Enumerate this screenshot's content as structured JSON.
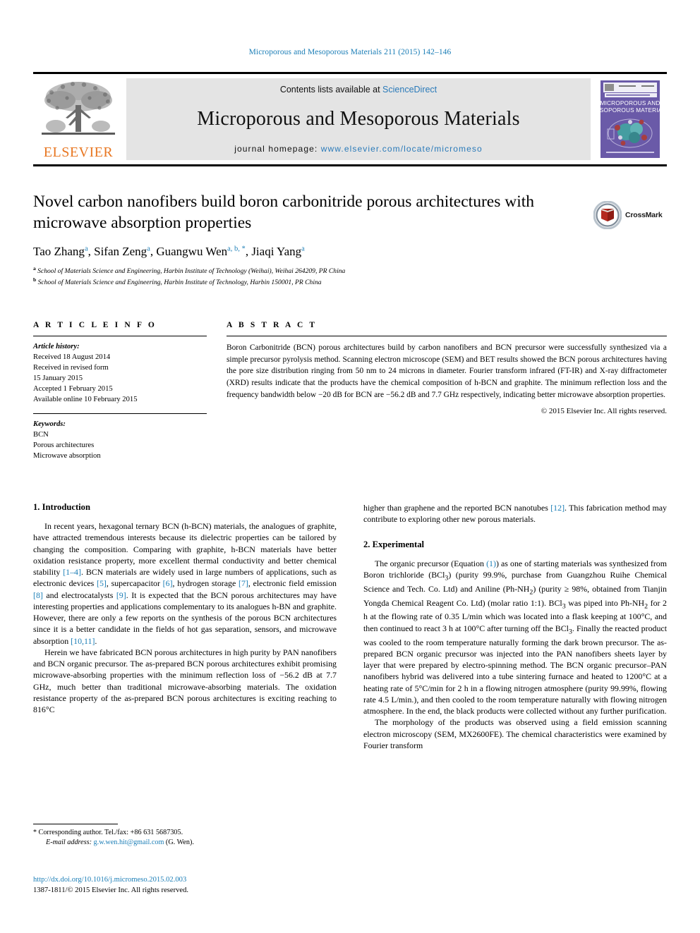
{
  "running_head": "Microporous and Mesoporous Materials 211 (2015) 142–146",
  "masthead": {
    "publisher_name": "ELSEVIER",
    "contents_prefix": "Contents lists available at ",
    "contents_link": "ScienceDirect",
    "journal_title": "Microporous and Mesoporous Materials",
    "homepage_prefix": "journal homepage: ",
    "homepage_link": "www.elsevier.com/locate/micromeso",
    "cover_title_line1": "MICROPOROUS AND",
    "cover_title_line2": "MESOPOROUS MATERIALS"
  },
  "article": {
    "title": "Novel carbon nanofibers build boron carbonitride porous architectures with microwave absorption properties",
    "authors": [
      {
        "name": "Tao Zhang",
        "marks": "a"
      },
      {
        "name": "Sifan Zeng",
        "marks": "a"
      },
      {
        "name": "Guangwu Wen",
        "marks": "a, b, *"
      },
      {
        "name": "Jiaqi Yang",
        "marks": "a"
      }
    ],
    "affiliations": [
      {
        "mark": "a",
        "text": "School of Materials Science and Engineering, Harbin Institute of Technology (Weihai), Weihai 264209, PR China"
      },
      {
        "mark": "b",
        "text": "School of Materials Science and Engineering, Harbin Institute of Technology, Harbin 150001, PR China"
      }
    ],
    "crossmark_label": "CrossMark"
  },
  "article_info": {
    "heading": "A R T I C L E   I N F O",
    "history_label": "Article history:",
    "history": [
      "Received 18 August 2014",
      "Received in revised form",
      "15 January 2015",
      "Accepted 1 February 2015",
      "Available online 10 February 2015"
    ],
    "keywords_label": "Keywords:",
    "keywords": [
      "BCN",
      "Porous architectures",
      "Microwave absorption"
    ]
  },
  "abstract": {
    "heading": "A B S T R A C T",
    "text": "Boron Carbonitride (BCN) porous architectures build by carbon nanofibers and BCN precursor were successfully synthesized via a simple precursor pyrolysis method. Scanning electron microscope (SEM) and BET results showed the BCN porous architectures having the pore size distribution ringing from 50 nm to 24 microns in diameter. Fourier transform infrared (FT-IR) and X-ray diffractometer (XRD) results indicate that the products have the chemical composition of h-BCN and graphite. The minimum reflection loss and the frequency bandwidth below −20 dB for BCN are −56.2 dB and 7.7 GHz respectively, indicating better microwave absorption properties.",
    "copyright": "© 2015 Elsevier Inc. All rights reserved."
  },
  "sections": {
    "introduction_heading": "1. Introduction",
    "intro_p1_a": "In recent years, hexagonal ternary BCN (h-BCN) materials, the analogues of graphite, have attracted tremendous interests because its dielectric properties can be tailored by changing the composition. Comparing with graphite, h-BCN materials have better oxidation resistance property, more excellent thermal conductivity and better chemical stability ",
    "intro_ref_1_4": "[1–4]",
    "intro_p1_b": ". BCN materials are widely used in large numbers of applications, such as electronic devices ",
    "intro_ref_5": "[5]",
    "intro_p1_c": ", supercapacitor ",
    "intro_ref_6": "[6]",
    "intro_p1_d": ", hydrogen storage ",
    "intro_ref_7": "[7]",
    "intro_p1_e": ", electronic field emission ",
    "intro_ref_8": "[8]",
    "intro_p1_f": " and electrocatalysts ",
    "intro_ref_9": "[9]",
    "intro_p1_g": ". It is expected that the BCN porous architectures may have interesting properties and applications complementary to its analogues h-BN and graphite. However, there are only a few reports on the synthesis of the porous BCN architectures since it is a better candidate in the fields of hot gas separation, sensors, and microwave absorption ",
    "intro_ref_10_11": "[10,11]",
    "intro_p1_h": ".",
    "intro_p2": "Herein we have fabricated BCN porous architectures in high purity by PAN nanofibers and BCN organic precursor. The as-prepared BCN porous architectures exhibit promising microwave-absorbing properties with the minimum reflection loss of −56.2 dB at 7.7 GHz, much better than traditional microwave-absorbing materials. The oxidation resistance property of the as-prepared BCN porous architectures is exciting reaching to 816°C",
    "right_p1_a": "higher than graphene and the reported BCN nanotubes ",
    "right_ref_12": "[12]",
    "right_p1_b": ". This fabrication method may contribute to exploring other new porous materials.",
    "experimental_heading": "2. Experimental",
    "exp_p1_a": "The organic precursor (Equation ",
    "exp_eq_ref": "(1)",
    "exp_p1_b": ") as one of starting materials was synthesized from Boron trichloride (BCl",
    "exp_p1_c": ") (purity 99.9%, purchase from Guangzhou Ruihe Chemical Science and Tech. Co. Ltd) and Aniline (Ph-NH",
    "exp_p1_d": ") (purity ≥ 98%, obtained from Tianjin Yongda Chemical Reagent Co. Ltd) (molar ratio 1:1). BCl",
    "exp_p1_e": " was piped into Ph-NH",
    "exp_p1_f": " for 2 h at the flowing rate of 0.35 L/min which was located into a flask keeping at 100°C, and then continued to react 3 h at 100°C after turning off the BCl",
    "exp_p1_g": ". Finally the reacted product was cooled to the room temperature naturally forming the dark brown precursor. The as-prepared BCN organic precursor was injected into the PAN nanofibers sheets layer by layer that were prepared by electro-spinning method. The BCN organic precursor–PAN nanofibers hybrid was delivered into a tube sintering furnace and heated to 1200°C at a heating rate of 5°C/min for 2 h in a flowing nitrogen atmosphere (purity 99.99%, flowing rate 4.5 L/min.), and then cooled to the room temperature naturally with flowing nitrogen atmosphere. In the end, the black products were collected without any further purification.",
    "exp_p2": "The morphology of the products was observed using a field emission scanning electron microscopy (SEM, MX2600FE). The chemical characteristics were examined by Fourier transform",
    "sub_3": "3",
    "sub_2": "2"
  },
  "footnotes": {
    "corresponding": "Corresponding author. Tel./fax: +86 631 5687305.",
    "email_label": "E-mail address:",
    "email": "g.w.wen.hit@gmail.com",
    "email_suffix": "(G. Wen).",
    "doi": "http://dx.doi.org/10.1016/j.micromeso.2015.02.003",
    "issn_line": "1387-1811/© 2015 Elsevier Inc. All rights reserved."
  },
  "colors": {
    "link_blue": "#1a7db6",
    "elsevier_orange": "#E87722",
    "masthead_grey": "#e4e4e4",
    "cover_purple": "#6a5aa8"
  }
}
